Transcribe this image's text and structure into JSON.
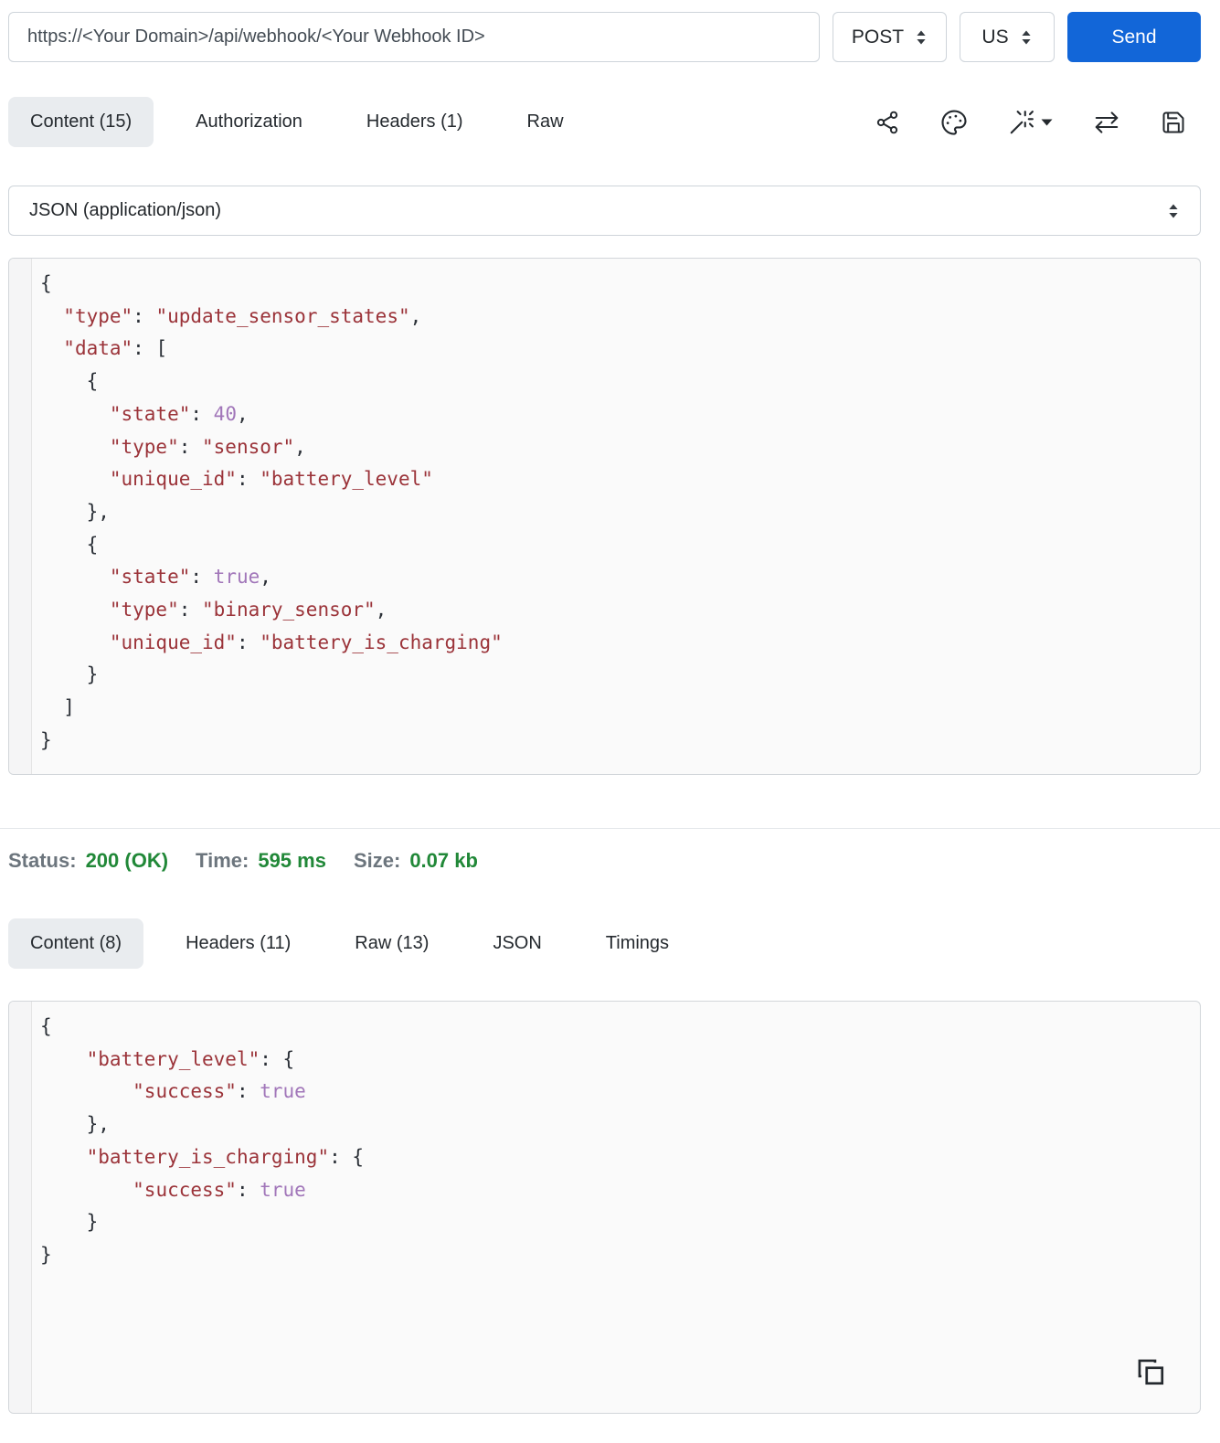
{
  "request_bar": {
    "url": "https://<Your Domain>/api/webhook/<Your Webhook ID>",
    "method": "POST",
    "region": "US",
    "send_label": "Send"
  },
  "request_tabs": {
    "items": [
      {
        "label": "Content (15)",
        "active": true
      },
      {
        "label": "Authorization",
        "active": false
      },
      {
        "label": "Headers (1)",
        "active": false
      },
      {
        "label": "Raw",
        "active": false
      }
    ]
  },
  "toolbar": {
    "icons": [
      "share-icon",
      "palette-icon",
      "magic-wand-icon",
      "swap-arrows-icon",
      "save-icon"
    ]
  },
  "content_type_select": {
    "value": "JSON (application/json)"
  },
  "request_body": "{\n  \"type\": \"update_sensor_states\",\n  \"data\": [\n    {\n      \"state\": 40,\n      \"type\": \"sensor\",\n      \"unique_id\": \"battery_level\"\n    },\n    {\n      \"state\": true,\n      \"type\": \"binary_sensor\",\n      \"unique_id\": \"battery_is_charging\"\n    }\n  ]\n}",
  "status_bar": {
    "status_label": "Status:",
    "status_value": "200 (OK)",
    "time_label": "Time:",
    "time_value": "595 ms",
    "size_label": "Size:",
    "size_value": "0.07 kb"
  },
  "response_tabs": {
    "items": [
      {
        "label": "Content (8)",
        "active": true
      },
      {
        "label": "Headers (11)",
        "active": false
      },
      {
        "label": "Raw (13)",
        "active": false
      },
      {
        "label": "JSON",
        "active": false
      },
      {
        "label": "Timings",
        "active": false
      }
    ]
  },
  "response_body": "{\n    \"battery_level\": {\n        \"success\": true\n    },\n    \"battery_is_charging\": {\n        \"success\": true\n    }\n}",
  "colors": {
    "accent_blue": "#1266d8",
    "success_green": "#218838",
    "label_gray": "#6c757d",
    "code_string": "#9b3339",
    "code_literal": "#a176b9",
    "active_tab_bg": "#e9ecef"
  }
}
